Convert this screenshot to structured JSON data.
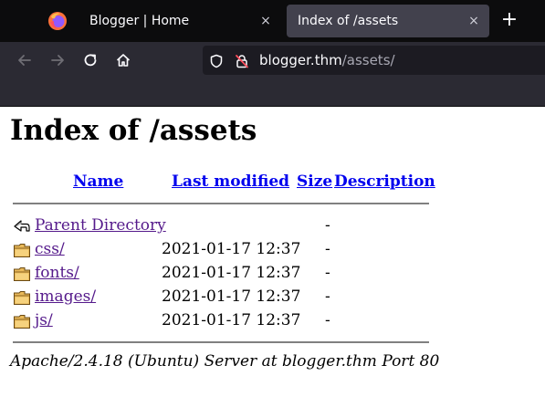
{
  "browser": {
    "tabs": [
      {
        "title": "Blogger | Home",
        "close_icon": "×"
      },
      {
        "title": "Index of /assets",
        "close_icon": "×"
      }
    ],
    "new_tab_label": "+",
    "url": {
      "host": "blogger.thm",
      "path": "/assets/"
    }
  },
  "page": {
    "heading": "Index of /assets",
    "columns": [
      "Name",
      "Last modified",
      "Size",
      "Description"
    ],
    "rows": [
      {
        "name": "Parent Directory",
        "modified": "",
        "size": "-",
        "icon": "back-arrow-icon"
      },
      {
        "name": "css/",
        "modified": "2021-01-17 12:37",
        "size": "-",
        "icon": "folder-icon"
      },
      {
        "name": "fonts/",
        "modified": "2021-01-17 12:37",
        "size": "-",
        "icon": "folder-icon"
      },
      {
        "name": "images/",
        "modified": "2021-01-17 12:37",
        "size": "-",
        "icon": "folder-icon"
      },
      {
        "name": "js/",
        "modified": "2021-01-17 12:37",
        "size": "-",
        "icon": "folder-icon"
      }
    ],
    "footer": "Apache/2.4.18 (Ubuntu) Server at blogger.thm Port 80"
  },
  "colors": {
    "tabbar_bg": "#0c0c0d",
    "active_tab_bg": "#42414d",
    "toolbar_bg": "#2b2a33",
    "link": "#0000ee",
    "visited_link": "#551a8b"
  }
}
